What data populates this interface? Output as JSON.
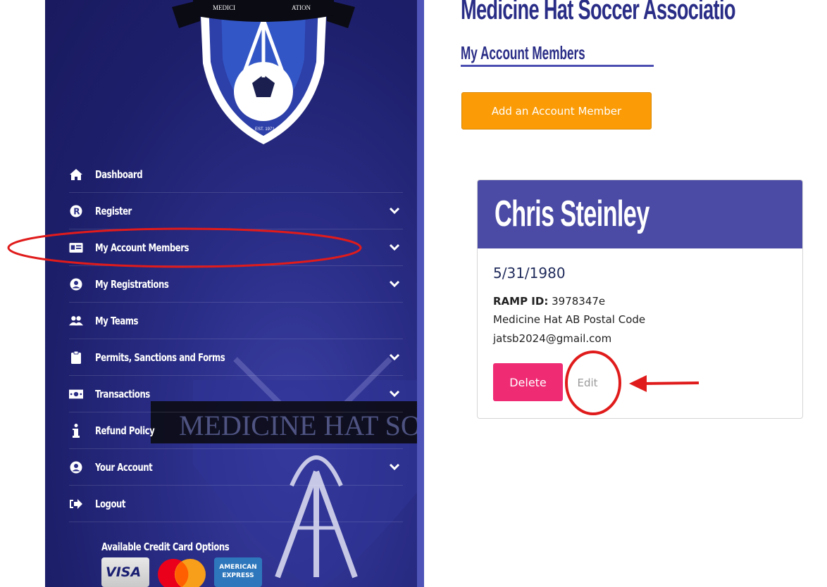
{
  "org": {
    "title": "Medicine Hat Soccer Associatio"
  },
  "page": {
    "title": "My Account Members"
  },
  "sidebar": {
    "items": [
      {
        "label": "Dashboard",
        "icon": "home-icon",
        "has_chevron": false
      },
      {
        "label": "Register",
        "icon": "r-circle-icon",
        "has_chevron": true
      },
      {
        "label": "My Account Members",
        "icon": "id-card-icon",
        "has_chevron": true
      },
      {
        "label": "My Registrations",
        "icon": "user-circle-icon",
        "has_chevron": true
      },
      {
        "label": "My Teams",
        "icon": "users-icon",
        "has_chevron": false
      },
      {
        "label": "Permits, Sanctions and Forms",
        "icon": "clipboard-icon",
        "has_chevron": true
      },
      {
        "label": "Transactions",
        "icon": "money-bill-icon",
        "has_chevron": true
      },
      {
        "label": "Refund Policy",
        "icon": "info-icon",
        "has_chevron": false
      },
      {
        "label": "Your Account",
        "icon": "user-circle-icon",
        "has_chevron": true
      },
      {
        "label": "Logout",
        "icon": "logout-icon",
        "has_chevron": false
      }
    ],
    "credit_cards_title": "Available Credit Card Options",
    "cards": {
      "visa": "VISA",
      "amex_line1": "AMERICAN",
      "amex_line2": "EXPRESS"
    },
    "watermark_text": "MEDICINE HAT SOCCER ASSOCI",
    "logo_text": "MEDICI",
    "logo_text_right": "ATION",
    "logo_est": "EST. 1971"
  },
  "main": {
    "add_button": "Add an Account Member",
    "member": {
      "name": "Chris Steinley",
      "dob": "5/31/1980",
      "ramp_label": "RAMP ID:",
      "ramp_id": "3978347e",
      "location": "Medicine Hat AB Postal Code",
      "email": "jatsb2024@gmail.com",
      "delete_label": "Delete",
      "edit_label": "Edit"
    }
  },
  "colors": {
    "sidebar": "#2a2d86",
    "accent_orange": "#fb9c07",
    "delete_pink": "#ef2b74",
    "card_header": "#4b4ba6",
    "annotation_red": "#e01b1b"
  }
}
